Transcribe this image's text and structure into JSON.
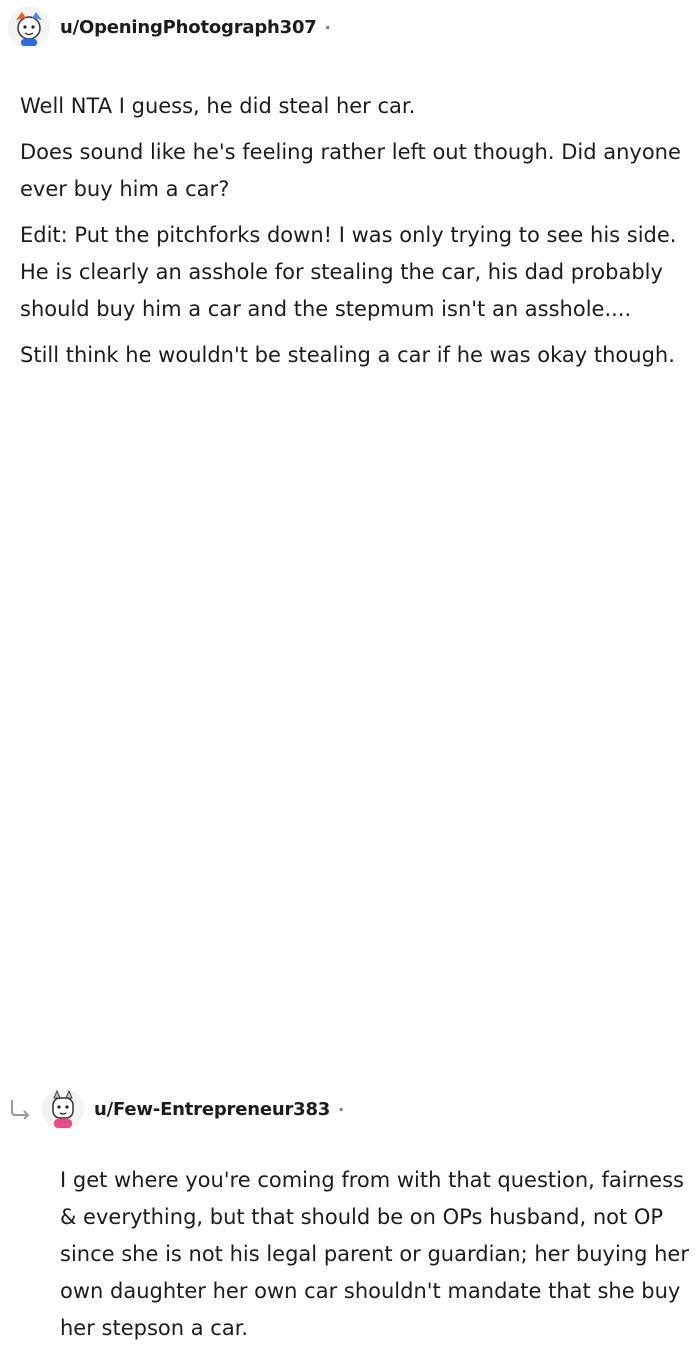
{
  "comment1": {
    "username": "u/OpeningPhotograph307",
    "separator": "·",
    "avatar": "user-avatar-icon",
    "paragraphs": [
      "Well NTA I guess, he did steal her car.",
      "Does sound like he's feeling rather left out though. Did anyone ever buy him a car?",
      "Edit: Put the pitchforks down! I was only trying to see his side. He is clearly an asshole for stealing the car, his dad probably should buy him a car and the stepmum isn't an asshole....",
      "Still think he wouldn't be stealing a car if he was okay though."
    ]
  },
  "comment2": {
    "username": "u/Few-Entrepreneur383",
    "separator": "·",
    "avatar": "user-avatar-icon",
    "reply_icon": "reply-arrow-icon",
    "paragraphs": [
      "I get where you're coming from with that question, fairness & everything, but that should be on OPs husband, not OP since she is not his legal parent or guardian; her buying her own daughter her own car shouldn't mandate that she buy her stepson a car."
    ]
  },
  "colors": {
    "text": "#1c1c1c",
    "muted": "#7c7c7c",
    "background": "#ffffff"
  }
}
